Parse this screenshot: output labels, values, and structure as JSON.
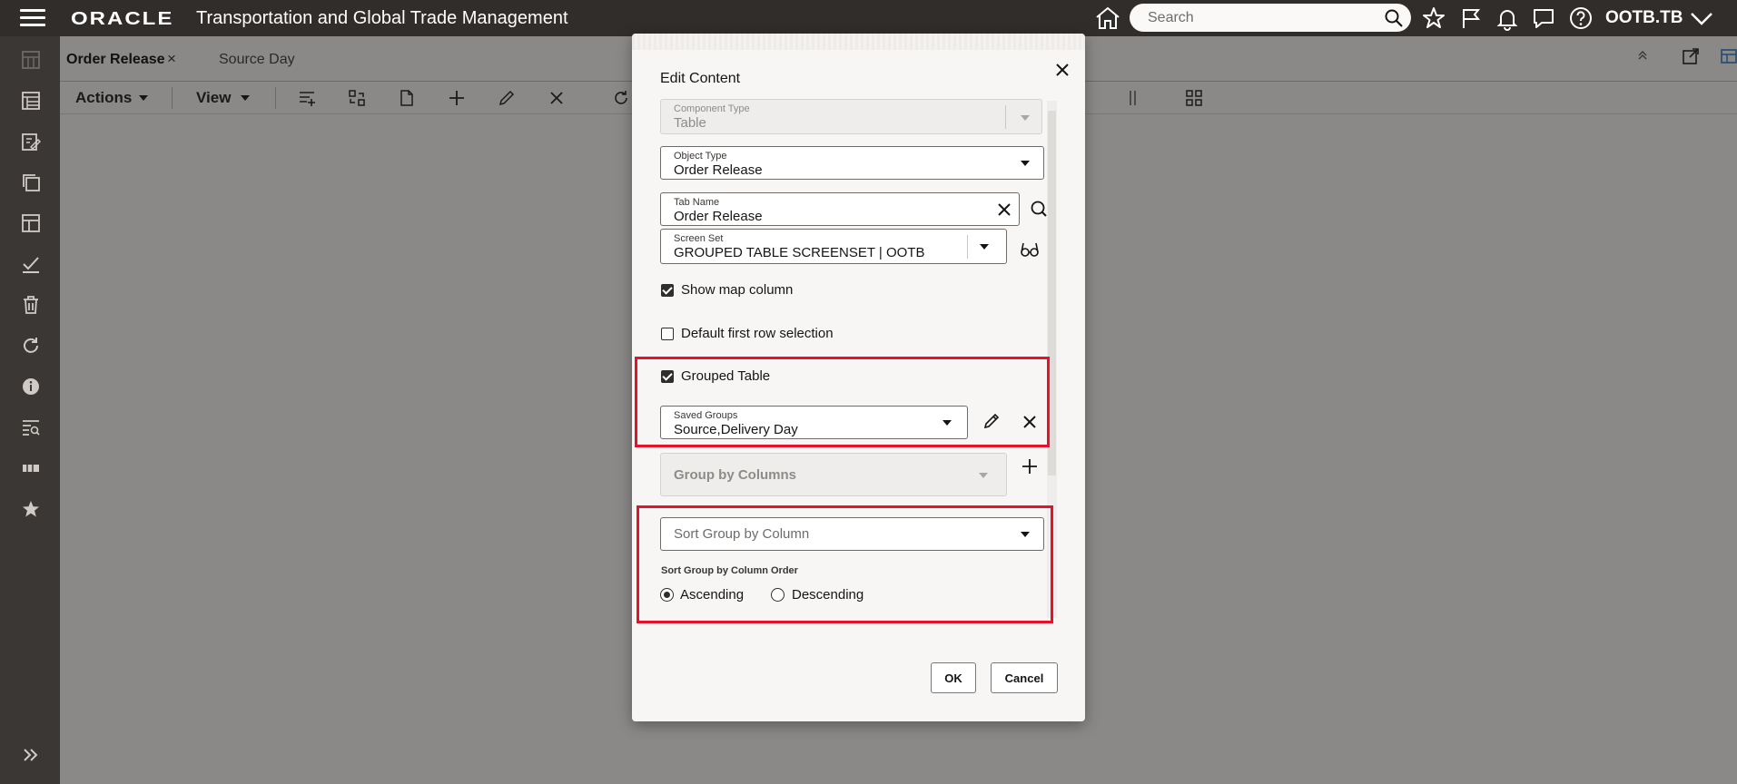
{
  "header": {
    "logo": "ORACLE",
    "app_title": "Transportation and Global Trade Management",
    "search_placeholder": "Search",
    "user": "OOTB.TB"
  },
  "tabs": [
    {
      "label": "Order Release",
      "close": "×"
    },
    {
      "label": "Source Day"
    }
  ],
  "toolbar": {
    "actions_label": "Actions",
    "view_label": "View"
  },
  "dialog": {
    "title": "Edit Content",
    "component_type": {
      "label": "Component Type",
      "value": "Table"
    },
    "object_type": {
      "label": "Object Type",
      "value": "Order Release"
    },
    "tab_name": {
      "label": "Tab Name",
      "value": "Order Release"
    },
    "screen_set": {
      "label": "Screen Set",
      "value": "GROUPED TABLE SCREENSET | OOTB"
    },
    "show_map_column": {
      "label": "Show map column",
      "checked": true
    },
    "default_first_row": {
      "label": "Default first row selection",
      "checked": false
    },
    "grouped_table": {
      "label": "Grouped Table",
      "checked": true
    },
    "saved_groups": {
      "label": "Saved Groups",
      "value": "Source,Delivery Day"
    },
    "group_by_columns": {
      "placeholder": "Group by Columns"
    },
    "sort_group_by_column": {
      "placeholder": "Sort Group by Column"
    },
    "sort_order": {
      "label": "Sort Group by Column Order",
      "options": [
        "Ascending",
        "Descending"
      ],
      "selected": "Ascending"
    },
    "ok_label": "OK",
    "cancel_label": "Cancel"
  },
  "colors": {
    "header_bg": "#312d2a",
    "highlight": "#e4132a",
    "overlay_bg": "#8a8988"
  }
}
